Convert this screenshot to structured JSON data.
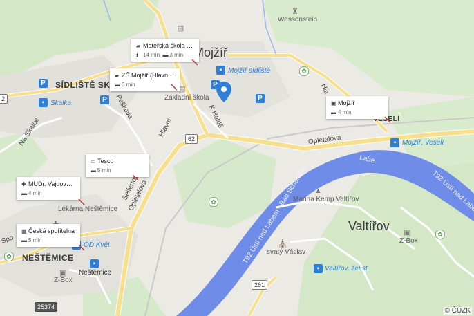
{
  "colors": {
    "river": "#6f8de8",
    "green": "#cfe5c4",
    "road_yellow": "#f8df8e",
    "road_white": "#ffffff",
    "transit": "#2f7fd6",
    "background": "#eceae4"
  },
  "places": {
    "mojzir": "Mojžíř",
    "valtirov": "Valtířov",
    "sidliste": "SÍDLIŠTĚ SKALKA",
    "nestemice": "NEŠTĚMICE",
    "vesely": "VESELÍ",
    "wessenstein": "Wessenstein",
    "marina": "Marina Kemp Valtířov",
    "svaty_vaclav": "svatý Václav",
    "zakladni_skola": "Základní škola",
    "lekarna": "Lékárna Neštěmice",
    "labe": "Labe"
  },
  "roads": {
    "opletalova_top": "Opletalova",
    "opletalova_left": "Opletalova",
    "hlavni": "Hlavní",
    "k_halde": "K Haldě",
    "peskova": "Peškova",
    "na_skalce": "Na Skalce",
    "seifertova": "Seifertova",
    "hlavni_right": "Hla",
    "t92_river": "T92 Ústí nad Labem - Bad Schandau",
    "t92_south": "T92 Ústí nad Labem - Bad Schandau",
    "t92_east": "T92 Ústí nad Labem - Ba",
    "sporil": "Spo"
  },
  "transit_stops": {
    "mojzir_sidliste": "Mojžíř sídliště",
    "skalka": "Skalka",
    "mojzir_veseli": "Mojžíř, Veselí",
    "od_kvet": "OD Květ",
    "nestemice": "Neštěmice",
    "valtirov_zel": "Valtířov, žel.st."
  },
  "road_numbers": {
    "r62": "62",
    "r261": "261",
    "r25374": "25374"
  },
  "zbox": {
    "a": "Z-Box",
    "b": "Z-Box"
  },
  "cards": [
    {
      "title": "Mateřská škola P...",
      "icon": "school-icon",
      "walk": "14 min",
      "drive": "3 min"
    },
    {
      "title": "ZŠ Mojžíř (Hlavní ...",
      "icon": "school-icon",
      "drive": "3 min"
    },
    {
      "title": "Mojžíř",
      "icon": "bus-icon",
      "drive": "4 min"
    },
    {
      "title": "Tesco",
      "icon": "cart-icon",
      "drive": "5 min"
    },
    {
      "title": "MUDr. Vajdová H...",
      "icon": "medical-icon",
      "drive": "4 min"
    },
    {
      "title": "Česká spořitelna",
      "icon": "bank-icon",
      "drive": "5 min"
    }
  ],
  "copyright": "© ČÚZK"
}
